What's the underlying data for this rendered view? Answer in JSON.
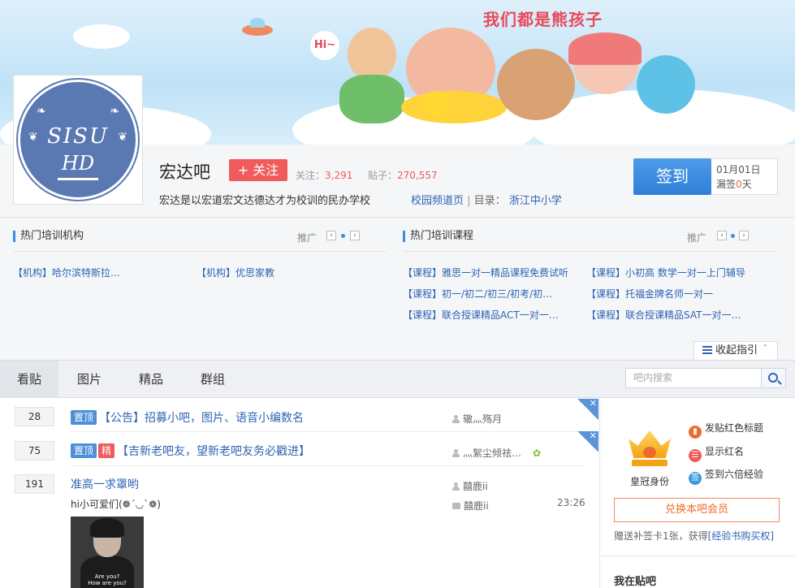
{
  "banner": {
    "slogan": "我们都是熊孩子",
    "hi_bubble": "Hi~"
  },
  "logo": {
    "line1": "SISU",
    "line2": "HD"
  },
  "forum": {
    "name": "宏达吧",
    "follow_label": "+ 关注",
    "followers_label": "关注：",
    "followers": "3,291",
    "posts_label": "贴子：",
    "posts": "270,557",
    "slogan": "宏达是以宏道宏文达德达才为校训的民办学校",
    "campus_link": "校园频道页",
    "catalog_label": "目录：",
    "catalog_value": "浙江中小学"
  },
  "signin": {
    "button": "签到",
    "date": "01月01日",
    "missed_prefix": "漏签",
    "missed_count": "0",
    "missed_suffix": "天"
  },
  "promo": {
    "left_title": "热门培训机构",
    "right_title": "热门培训课程",
    "tui_label": "推广",
    "prev": "‹",
    "next": "›",
    "left_items": [
      "【机构】哈尔滨特斯拉…",
      "【机构】优思家教"
    ],
    "right_items": [
      "【课程】雅思一对一精品课程免费试听",
      "【课程】小初高 数学一对一上门辅导",
      "【课程】初一/初二/初三/初考/初…",
      "【课程】托福金牌名师一对一",
      "【课程】联合授课精品ACT一对一…",
      "【课程】联合授课精品SAT一对一…"
    ],
    "collapse": "收起指引"
  },
  "tabs": [
    "看贴",
    "图片",
    "精品",
    "群组"
  ],
  "search": {
    "placeholder": "吧内搜索"
  },
  "threads": [
    {
      "replies": "28",
      "tags": [
        "置顶"
      ],
      "title": "【公告】招募小吧，图片、语音小编数名",
      "author": "辙灬殇月"
    },
    {
      "replies": "75",
      "tags": [
        "置顶",
        "精"
      ],
      "title": "【吉新老吧友，望新老吧友务必戳进】",
      "author": "灬絮尘倾祛…"
    },
    {
      "replies": "191",
      "tags": [],
      "title": "准高一求罩哟",
      "snippet": "hi小可爱们(❁´◡`❁)",
      "author": "囍鹿ii",
      "last_reply": "囍鹿ii",
      "time": "23:26",
      "thumb_caption": "Are you?\nHow are you?"
    }
  ],
  "member": {
    "crown_label": "皇冠身份",
    "perks": [
      "发贴红色标题",
      "显示红名",
      "签到六倍经验"
    ],
    "perk_icons": [
      "bookmark-icon",
      "chat-icon",
      "sign-icon"
    ],
    "perk_glyphs": [
      "▮",
      "☰",
      "签"
    ],
    "exchange": "兑换本吧会员",
    "gift_text": "赠送补签卡1张，获得",
    "gift_link": "[经验书购买权]"
  },
  "in_bar_title": "我在贴吧",
  "colors": {
    "accent": "#2d64b3",
    "red": "#f05b5b",
    "blue_btn": "#2f7fd9",
    "orange": "#f06b2b"
  }
}
